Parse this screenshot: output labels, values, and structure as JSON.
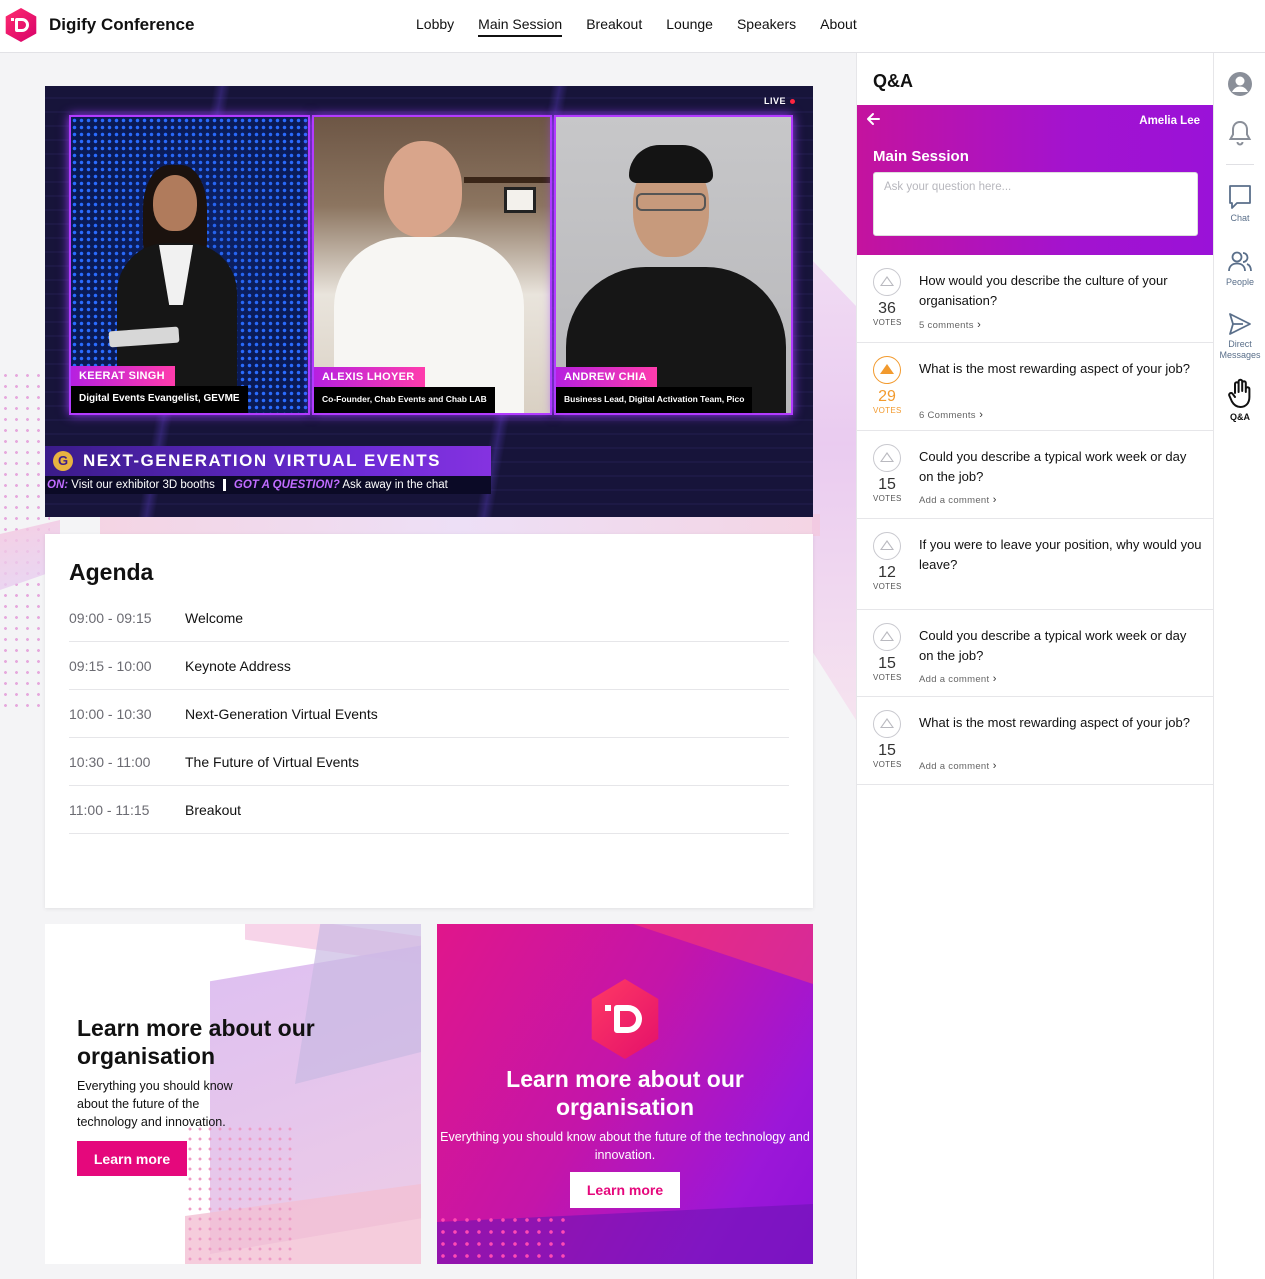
{
  "app": {
    "name": "Digify Conference"
  },
  "nav": [
    {
      "label": "Lobby",
      "active": false
    },
    {
      "label": "Main Session",
      "active": true
    },
    {
      "label": "Breakout",
      "active": false
    },
    {
      "label": "Lounge",
      "active": false
    },
    {
      "label": "Speakers",
      "active": false
    },
    {
      "label": "About",
      "active": false
    }
  ],
  "video": {
    "live_label": "LIVE",
    "speakers": [
      {
        "name": "KEERAT SINGH",
        "role": "Digital Events Evangelist, GEVME"
      },
      {
        "name": "ALEXIS LHOYER",
        "role": "Co-Founder, Chab Events and Chab LAB"
      },
      {
        "name": "ANDREW CHIA",
        "role": "Business Lead, Digital Activation Team, Pico"
      }
    ],
    "banner_icon": "G",
    "banner_title": "NEXT-GENERATION VIRTUAL EVENTS",
    "ticker": {
      "lead": "ON:",
      "text1": "Visit our exhibitor 3D booths",
      "highlight": "GOT A QUESTION?",
      "text2": "Ask away in the chat"
    }
  },
  "agenda": {
    "title": "Agenda",
    "items": [
      {
        "time": "09:00 - 09:15",
        "name": "Welcome"
      },
      {
        "time": "09:15 - 10:00",
        "name": "Keynote Address"
      },
      {
        "time": "10:00 - 10:30",
        "name": "Next-Generation Virtual Events"
      },
      {
        "time": "10:30 - 11:00",
        "name": "The Future of Virtual Events"
      },
      {
        "time": "11:00 - 11:15",
        "name": "Breakout"
      }
    ]
  },
  "promo_left": {
    "title": "Learn more about our organisation",
    "description": "Everything you should know about the future of the technology and innovation.",
    "button": "Learn more"
  },
  "promo_right": {
    "title": "Learn more about our organisation",
    "description_line1": "Everything you should know about the future of the technology and",
    "description_line2": "innovation.",
    "button": "Learn more"
  },
  "qa": {
    "title": "Q&A",
    "user": "Amelia Lee",
    "session": "Main Session",
    "placeholder": "Ask your question here...",
    "votes_label": "VOTES",
    "questions": [
      {
        "text": "How would you describe the culture of your organisation?",
        "votes": "36",
        "comments": "5 comments",
        "voted": false,
        "height": 88,
        "ctop": 64
      },
      {
        "text": "What is the most rewarding aspect of your job?",
        "votes": "29",
        "comments": "6 Comments",
        "voted": true,
        "height": 88,
        "ctop": 66
      },
      {
        "text": "Could you describe a typical work week or day on the job?",
        "votes": "15",
        "comments": "Add a comment",
        "voted": false,
        "height": 88,
        "ctop": 63
      },
      {
        "text": "If you were to leave your position, why would you leave?",
        "votes": "12",
        "comments": "",
        "voted": false,
        "height": 91,
        "ctop": 0
      },
      {
        "text": "Could you describe a typical work week or day on the job?",
        "votes": "15",
        "comments": "Add a comment",
        "voted": false,
        "height": 87,
        "ctop": 63
      },
      {
        "text": "What is the most rewarding aspect of your job?",
        "votes": "15",
        "comments": "Add a comment",
        "voted": false,
        "height": 88,
        "ctop": 63
      }
    ]
  },
  "rail": {
    "chat": "Chat",
    "people": "People",
    "direct_line1": "Direct",
    "direct_line2": "Messages",
    "qa": "Q&A"
  }
}
